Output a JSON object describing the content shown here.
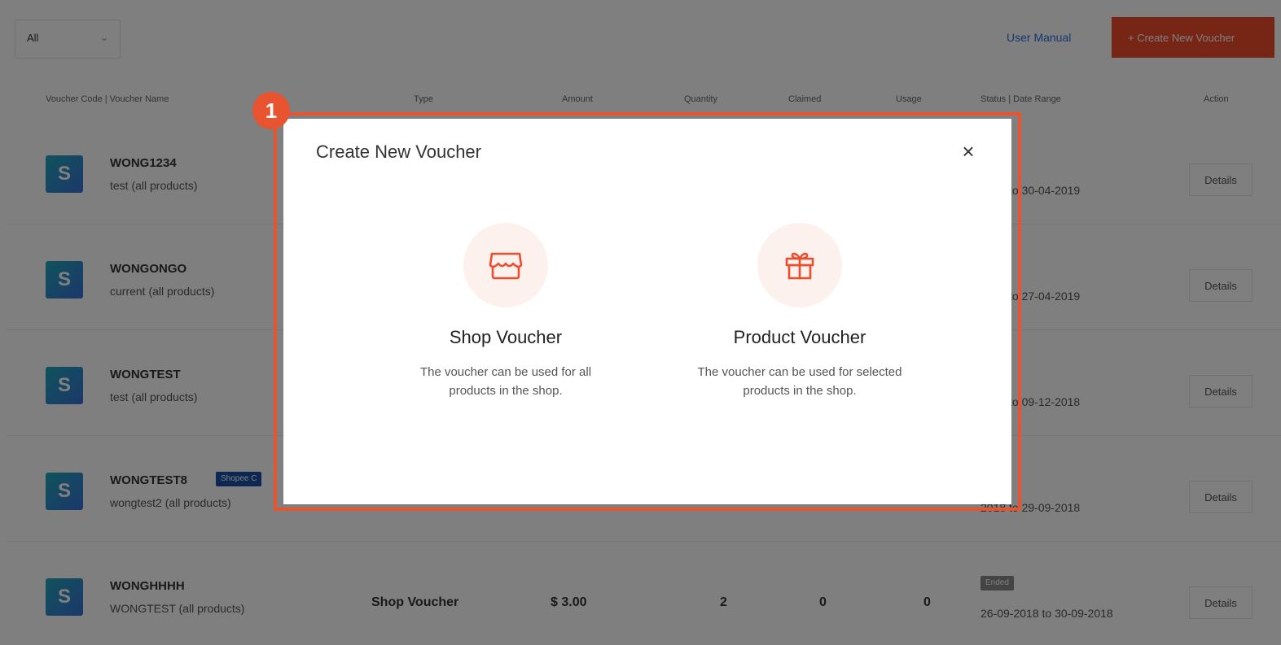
{
  "toolbar": {
    "filter_value": "All",
    "user_manual_label": "User Manual",
    "create_button_label": "+ Create New Voucher"
  },
  "table": {
    "headers": [
      "Voucher Code | Voucher Name",
      "Type",
      "Amount",
      "Quantity",
      "Claimed",
      "Usage",
      "Status | Date Range",
      "Action"
    ],
    "rows": [
      {
        "code": "WONG1234",
        "name": "test (all products)",
        "badge": "",
        "type": "",
        "amount": "",
        "quantity": "",
        "claimed": "",
        "usage": "",
        "status": "",
        "date_range": "2019 to 30-04-2019",
        "action": "Details"
      },
      {
        "code": "WONGONGO",
        "name": "current (all products)",
        "badge": "",
        "type": "",
        "amount": "",
        "quantity": "",
        "claimed": "",
        "usage": "",
        "status": "",
        "date_range": "2019 to 27-04-2019",
        "action": "Details"
      },
      {
        "code": "WONGTEST",
        "name": "test (all products)",
        "badge": "",
        "type": "",
        "amount": "",
        "quantity": "",
        "claimed": "",
        "usage": "",
        "status": "",
        "date_range": "2018 to 09-12-2018",
        "action": "Details"
      },
      {
        "code": "WONGTEST8",
        "name": "wongtest2 (all products)",
        "badge": "Shopee C",
        "type": "",
        "amount": "",
        "quantity": "",
        "claimed": "",
        "usage": "",
        "status": "",
        "date_range": "2018 to 29-09-2018",
        "action": "Details"
      },
      {
        "code": "WONGHHHH",
        "name": "WONGTEST (all products)",
        "badge": "",
        "type": "Shop Voucher",
        "amount": "$ 3.00",
        "quantity": "2",
        "claimed": "0",
        "usage": "0",
        "status": "Ended",
        "date_range": "26-09-2018 to 30-09-2018",
        "action": "Details"
      }
    ]
  },
  "modal": {
    "title": "Create New Voucher",
    "close_symbol": "×",
    "options": [
      {
        "title": "Shop Voucher",
        "desc_line1": "The voucher can be used for all",
        "desc_line2": "products in the shop.",
        "icon": "shop-icon"
      },
      {
        "title": "Product Voucher",
        "desc_line1": "The voucher can be used for selected",
        "desc_line2": "products in the shop.",
        "icon": "gift-icon"
      }
    ]
  },
  "annotation": {
    "step_number": "1"
  },
  "colors": {
    "accent": "#ee4d2d",
    "highlight": "#e8542f",
    "icon_bg": "#fdf1ed",
    "link": "#2673dd"
  }
}
